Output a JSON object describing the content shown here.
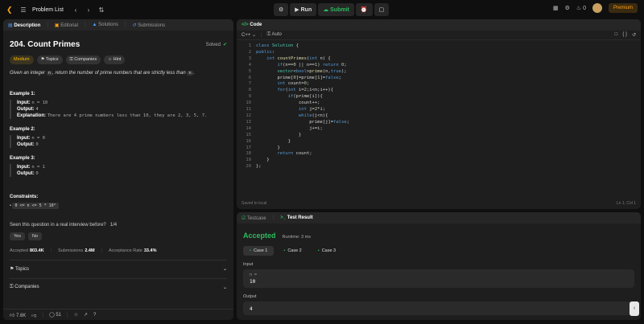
{
  "topbar": {
    "title": "Problem List",
    "run_label": "Run",
    "submit_label": "Submit",
    "streak": "0",
    "premium": "Premium"
  },
  "left": {
    "tabs": [
      "Description",
      "Editorial",
      "Solutions",
      "Submissions"
    ],
    "title": "204. Count Primes",
    "solved": "Solved",
    "tags": [
      "Medium",
      "Topics",
      "Companies",
      "Hint"
    ],
    "statement_pre": "Given an integer ",
    "statement_n": "n",
    "statement_post": ", return the number of prime numbers that are strictly less than ",
    "statement_n2": "n",
    "statement_end": ".",
    "examples": [
      {
        "title": "Example 1:",
        "input": "n = 10",
        "output": "4",
        "explanation": "There are 4 prime numbers less than 10, they are 2, 3, 5, 7."
      },
      {
        "title": "Example 2:",
        "input": "n = 0",
        "output": "0"
      },
      {
        "title": "Example 3:",
        "input": "n = 1",
        "output": "0"
      }
    ],
    "labels": {
      "input": "Input:",
      "output": "Output:",
      "explanation": "Explanation:"
    },
    "constraints_title": "Constraints:",
    "constraint": "0 <= n <= 5 * 10⁶",
    "seen": "Seen this question in a real interview before?",
    "seen_count": "1/4",
    "yes": "Yes",
    "no": "No",
    "stats": {
      "accepted_label": "Accepted",
      "accepted": "803.4K",
      "submissions_label": "Submissions",
      "submissions": "2.4M",
      "rate_label": "Acceptance Rate",
      "rate": "33.4%"
    },
    "topics_label": "Topics",
    "companies_label": "Companies",
    "likes": "7.6K",
    "comments": "51"
  },
  "code": {
    "title": "Code",
    "lang": "C++",
    "auto": "Auto",
    "saved": "Saved to local",
    "cursor": "Ln 1, Col 1"
  },
  "test": {
    "tabs": [
      "Testcase",
      "Test Result"
    ],
    "status": "Accepted",
    "runtime": "Runtime: 3 ms",
    "cases": [
      "Case 1",
      "Case 2",
      "Case 3"
    ],
    "input_label": "Input",
    "var": "n =",
    "input_value": "10",
    "output_label": "Output",
    "output_value": "4"
  }
}
